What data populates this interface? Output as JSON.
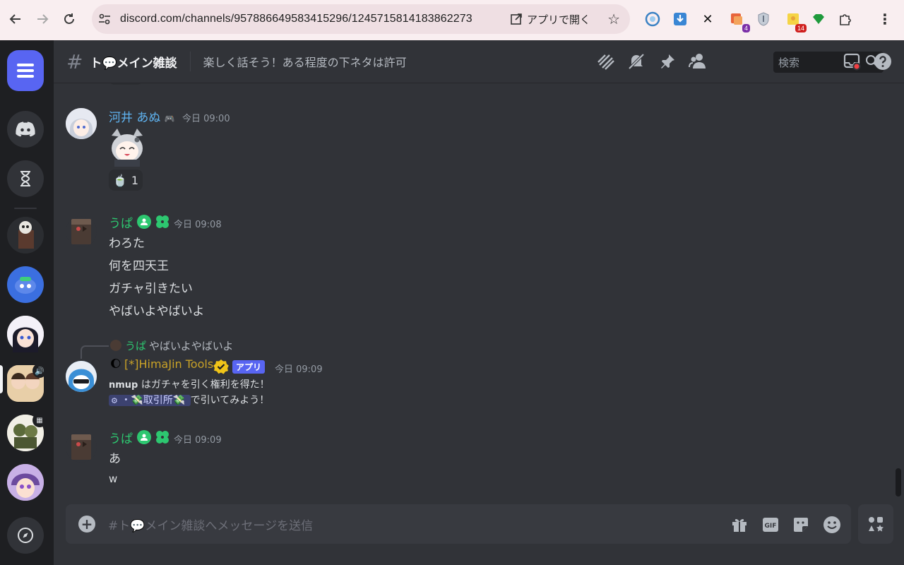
{
  "browser": {
    "url": "discord.com/channels/957886649583415296/1245715814183862273",
    "open_app_label": "アプリで開く",
    "extensions": [
      {
        "name": "ext-circle-icon",
        "badge": ""
      },
      {
        "name": "download-icon",
        "badge": ""
      },
      {
        "name": "x-icon",
        "badge": ""
      },
      {
        "name": "ext-translate-icon",
        "badge": "4",
        "badge_color": "#7b2fa8"
      },
      {
        "name": "shield-icon",
        "badge": ""
      },
      {
        "name": "ext-sticky-icon",
        "badge": "14",
        "badge_color": "#d0201f"
      },
      {
        "name": "gem-icon",
        "badge": ""
      },
      {
        "name": "puzzle-icon",
        "badge": ""
      }
    ]
  },
  "header": {
    "channel_name": "ト💬メイン雑談",
    "topic": "楽しく話そう！ある程度の下ネタは許可",
    "search_placeholder": "検索"
  },
  "messages": [
    {
      "author": "河井 あぬ",
      "author_suffix": "🎮",
      "author_color": "#5fb3f0",
      "timestamp": "今日 09:00",
      "reaction_emoji": "🍵",
      "reaction_count": "1"
    },
    {
      "author": "うぱ",
      "author_color": "#2dc770",
      "timestamp": "今日 09:08",
      "lines": [
        "わろた",
        "何を四天王",
        "ガチャ引きたい",
        "やばいよやばいよ"
      ]
    },
    {
      "reply_author": "うぱ",
      "reply_text": "やばいよやばいよ",
      "author": "[*]HimaJin Tools",
      "author_prefix": "🌔",
      "author_color": "#c9a227",
      "app_tag": "アプリ",
      "timestamp": "今日 09:09",
      "line1_user": "nmup",
      "line1_text": "はガチャを引く権利を得た！",
      "channel_mention": "・💸取引所💸",
      "line2_text": "で引いてみよう！"
    },
    {
      "author": "うぱ",
      "author_color": "#2dc770",
      "timestamp": "今日 09:09",
      "lines": [
        "あ",
        "w"
      ]
    }
  ],
  "composer": {
    "placeholder": "#ト💬メイン雑談へメッセージを送信"
  }
}
